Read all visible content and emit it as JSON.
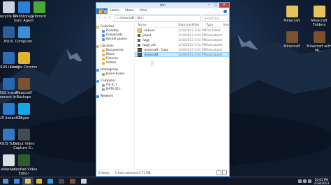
{
  "desktop": {
    "left_icons": [
      {
        "label": "Recycle Bin",
        "icon": "recycle-bin-icon",
        "color": "#c9d3df"
      },
      {
        "label": "WebStorage Sync Agent",
        "icon": "webstorage-icon",
        "color": "#2e7fd8"
      },
      {
        "label": "µTorrent",
        "icon": "utorrent-icon",
        "color": "#4aa83a"
      },
      {
        "label": "ASUS",
        "icon": "asus-icon",
        "color": "#2c5d9c"
      },
      {
        "label": "Computer",
        "icon": "computer-icon",
        "color": "#3c8fd6"
      },
      {
        "label": "ASUS Install",
        "icon": "asus-install-icon",
        "color": "#2d6db8"
      },
      {
        "label": "Google Chrome",
        "icon": "chrome-icon",
        "color": "#e0b431"
      },
      {
        "label": "ASUS Instant Connect In...",
        "icon": "asus-connect-icon",
        "color": "#2467b3"
      },
      {
        "label": "Minecraft Backups",
        "icon": "folder-icon",
        "color": "#7a5230"
      },
      {
        "label": "ASUS InstantOn",
        "icon": "asus-instanton-icon",
        "color": "#2a7bd0"
      },
      {
        "label": "Skype",
        "icon": "skype-icon",
        "color": "#17a7e3"
      },
      {
        "label": "ASUS Tutor",
        "icon": "asus-tutor-icon",
        "color": "#3577c4"
      },
      {
        "label": "Debut Video Capture S...",
        "icon": "debut-icon",
        "color": "#444b57"
      },
      {
        "label": "eManual",
        "icon": "emanual-icon",
        "color": "#d9dde4"
      },
      {
        "label": "VideoPad Video Editor",
        "icon": "videopad-icon",
        "color": "#2e5a2e"
      }
    ],
    "right_icons": [
      {
        "label": "Minecraft",
        "icon": "minecraft-folder-icon",
        "color": "#e7c25c"
      },
      {
        "label": "Minecraft Folders",
        "icon": "minecraft-folders-icon",
        "color": "#e7c25c"
      },
      {
        "label": "Minecraft",
        "icon": "minecraft-icon",
        "color": "#7a5230"
      },
      {
        "label": "Minecraft with ML...",
        "icon": "minecraft-ml-icon",
        "color": "#7a5230"
      }
    ]
  },
  "window": {
    "title": "bin",
    "ribbon_tabs": [
      "File",
      "Home",
      "Share",
      "View"
    ],
    "address_path": "« .minecraft  ›  bin  ›",
    "search_placeholder": "Search bin",
    "nav": {
      "favorites": "Favorites",
      "favorite_items": [
        "Desktop",
        "Downloads",
        "Recent places"
      ],
      "libraries": "Libraries",
      "library_items": [
        "Documents",
        "Music",
        "Pictures",
        "Videos"
      ],
      "homegroup": "Homegroup",
      "homegroup_items": [
        "Jessie Evans"
      ],
      "computer": "Computer",
      "computer_items": [
        "OS (C:)",
        "DATA (D:)"
      ],
      "network": "Network"
    },
    "columns": [
      "Name",
      "Date modified",
      "Type",
      "Size"
    ],
    "files": [
      {
        "name": "natives",
        "date": "2/18/2013 3:54 PM",
        "type": "File folder",
        "icon": "folder",
        "selected": false
      },
      {
        "name": "jinput",
        "date": "2/18/2013 3:54 PM",
        "type": "Executable Jar File",
        "icon": "file",
        "selected": false
      },
      {
        "name": "lwjgl",
        "date": "2/18/2013 3:54 PM",
        "type": "Executable Jar File",
        "icon": "file",
        "selected": false
      },
      {
        "name": "lwjgl_util",
        "date": "2/18/2013 3:54 PM",
        "type": "Executable Jar File",
        "icon": "file",
        "selected": false
      },
      {
        "name": "minecraft - Copy",
        "date": "2/18/2013 3:54 PM",
        "type": "Executable Jar File",
        "icon": "app",
        "selected": false
      },
      {
        "name": "minecraft",
        "date": "2/18/2013 3:54 PM",
        "type": "Executable Jar File",
        "icon": "app",
        "selected": true
      }
    ],
    "status": {
      "items": "6 items",
      "selected": "1 item selected  4.71 MB"
    }
  },
  "taskbar": {
    "apps": [
      {
        "icon": "ie-icon",
        "color": "#3b8fe0"
      },
      {
        "icon": "file-explorer-icon",
        "color": "#e8c15c"
      },
      {
        "icon": "chrome-icon",
        "color": "#e0b431"
      },
      {
        "icon": "skype-icon",
        "color": "#17a7e3"
      },
      {
        "icon": "debut-icon",
        "color": "#444b57"
      },
      {
        "icon": "minecraft-icon",
        "color": "#7a5230"
      },
      {
        "icon": "recycle-bin-icon",
        "color": "#c9d3df"
      }
    ],
    "time": "10:01 PM",
    "date": "2/18/2013"
  }
}
